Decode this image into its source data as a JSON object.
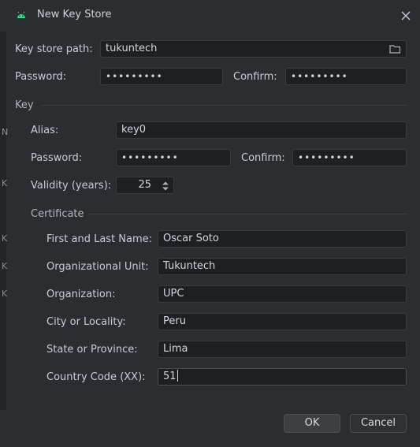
{
  "dialog": {
    "title": "New Key Store",
    "app_icon": "android-icon",
    "close_icon": "close-icon"
  },
  "keystore": {
    "path_label": "Key store path:",
    "path_value": "tukuntech",
    "folder_icon": "folder-icon",
    "password_label": "Password:",
    "password_value": "•••••••••",
    "confirm_label": "Confirm:",
    "confirm_value": "•••••••••"
  },
  "key": {
    "section_label": "Key",
    "alias_label": "Alias:",
    "alias_value": "key0",
    "password_label": "Password:",
    "password_value": "•••••••••",
    "confirm_label": "Confirm:",
    "confirm_value": "•••••••••",
    "validity_label": "Validity (years):",
    "validity_value": "25"
  },
  "certificate": {
    "section_label": "Certificate",
    "first_last_label": "First and Last Name:",
    "first_last_value": "Oscar Soto",
    "org_unit_label": "Organizational Unit:",
    "org_unit_value": "Tukuntech",
    "org_label": "Organization:",
    "org_value": "UPC",
    "city_label": "City or Locality:",
    "city_value": "Peru",
    "state_label": "State or Province:",
    "state_value": "Lima",
    "country_label": "Country Code (XX):",
    "country_value": "51"
  },
  "buttons": {
    "ok": "OK",
    "cancel": "Cancel"
  },
  "background_marks": [
    "N",
    "K",
    "K",
    "K",
    "K"
  ],
  "colors": {
    "dialog_bg": "#2b2d30",
    "field_bg": "#1e1f22",
    "android_green": "#3ddc84"
  }
}
